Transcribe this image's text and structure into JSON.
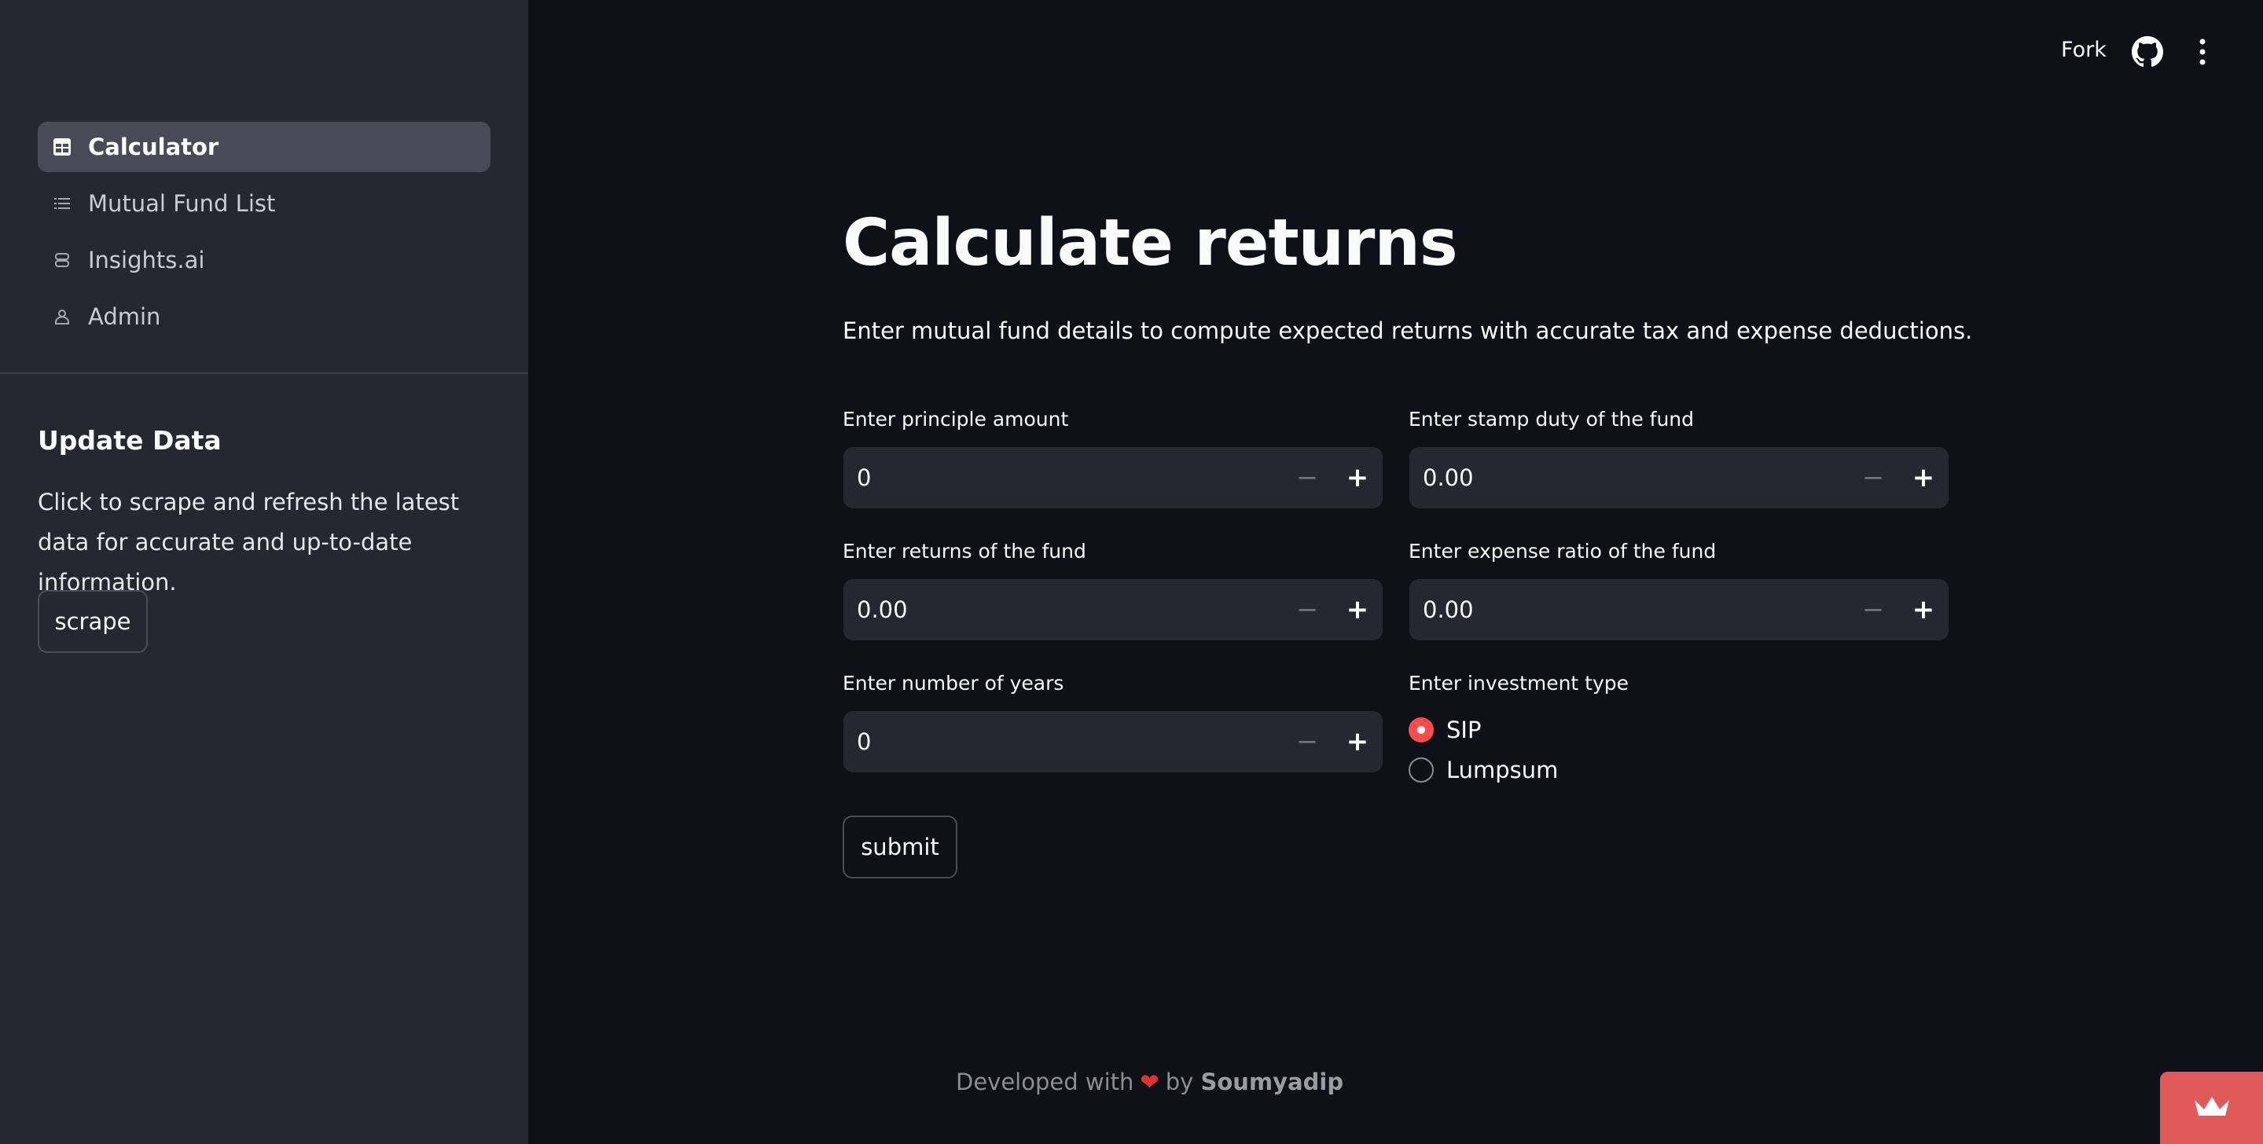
{
  "sidebar": {
    "nav": [
      {
        "label": "Calculator",
        "icon": "table-icon",
        "active": true
      },
      {
        "label": "Mutual Fund List",
        "icon": "list-icon",
        "active": false
      },
      {
        "label": "Insights.ai",
        "icon": "robot-icon",
        "active": false
      },
      {
        "label": "Admin",
        "icon": "person-icon",
        "active": false
      }
    ],
    "update_title": "Update Data",
    "update_text": "Click to scrape and refresh the latest data for accurate and up-to-date information.",
    "scrape_label": "scrape"
  },
  "header": {
    "fork_label": "Fork",
    "github_icon": "github-icon",
    "menu_icon": "vertical-dots-icon"
  },
  "main": {
    "title": "Calculate returns",
    "description": "Enter mutual fund details to compute expected returns with accurate tax and expense deductions.",
    "fields": {
      "principal": {
        "label": "Enter principle amount",
        "value": "0"
      },
      "stamp_duty": {
        "label": "Enter stamp duty of the fund",
        "value": "0.00"
      },
      "returns": {
        "label": "Enter returns of the fund",
        "value": "0.00"
      },
      "expense_ratio": {
        "label": "Enter expense ratio of the fund",
        "value": "0.00"
      },
      "years": {
        "label": "Enter number of years",
        "value": "0"
      }
    },
    "step_minus": "−",
    "step_plus": "+",
    "investment_type": {
      "label": "Enter investment type",
      "options": [
        "SIP",
        "Lumpsum"
      ],
      "selected": "SIP"
    },
    "submit_label": "submit"
  },
  "footer": {
    "prefix": "Developed with",
    "heart": "❤",
    "by": "by",
    "author": "Soumyadip"
  },
  "colors": {
    "background": "#0e1117",
    "sidebar": "#262730",
    "accent": "#ff4b4b",
    "badge": "#e05a5a"
  }
}
